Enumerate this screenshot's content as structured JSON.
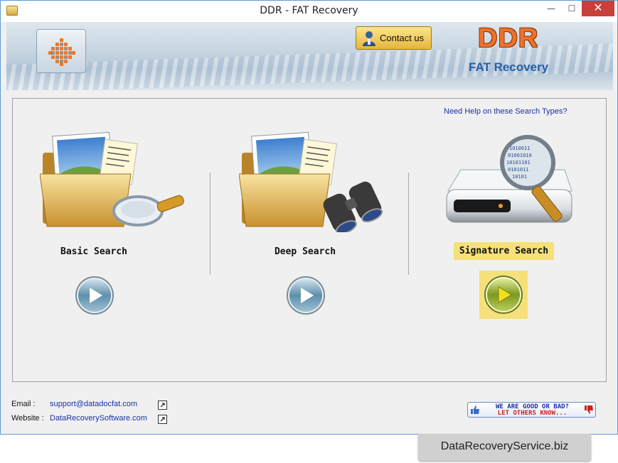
{
  "window": {
    "title": "DDR - FAT Recovery",
    "minimize": "—",
    "maximize": "☐",
    "close": "✕"
  },
  "header": {
    "contact_label": "Contact us",
    "brand": "DDR",
    "brand_subtitle": "FAT Recovery"
  },
  "main": {
    "help_link": "Need Help on these Search Types?",
    "search_types": [
      {
        "label": "Basic Search",
        "icon": "folder-magnifier-icon",
        "selected": false
      },
      {
        "label": "Deep Search",
        "icon": "folder-binoculars-icon",
        "selected": false
      },
      {
        "label": "Signature Search",
        "icon": "drive-magnifier-icon",
        "selected": true
      }
    ]
  },
  "footer": {
    "email_label": "Email :",
    "email": "support@datadocfat.com",
    "website_label": "Website :",
    "website": "DataRecoverySoftware.com",
    "feedback_line1": "WE ARE GOOD OR BAD?",
    "feedback_line2": "LET OTHERS KNOW..."
  },
  "watermark": "DataRecoveryService.biz",
  "colors": {
    "accent_yellow": "#f5e07a",
    "brand_orange": "#f0722a",
    "brand_blue": "#2360a8",
    "link_blue": "#1a2fa8"
  }
}
